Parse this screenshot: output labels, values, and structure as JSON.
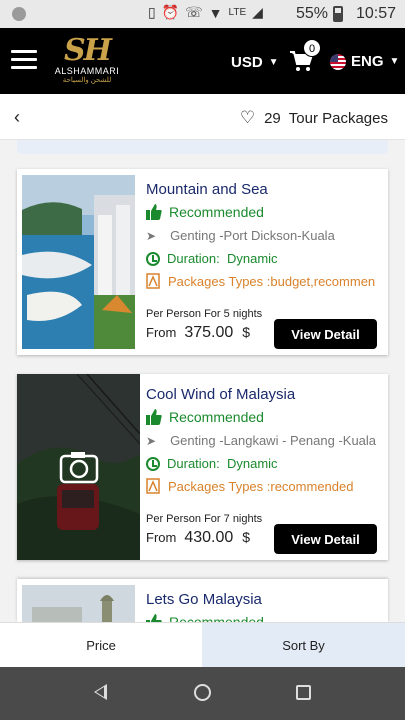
{
  "status_bar": {
    "battery": "55%",
    "time": "10:57",
    "network": "LTE"
  },
  "header": {
    "currency": "USD",
    "cart_count": "0",
    "language": "ENG",
    "logo_name": "ALSHAMMARI",
    "logo_sub": "للشحن والسياحة",
    "logo_mark": "SH"
  },
  "subheader": {
    "count": "29",
    "label": "Tour Packages"
  },
  "labels": {
    "recommended": "Recommended",
    "duration_prefix": "Duration:",
    "from": "From",
    "view_detail": "View Detail"
  },
  "packages": [
    {
      "title": "Mountain and Sea",
      "route": "Genting -Port Dickson-Kuala",
      "duration": "Dynamic",
      "types": "Packages Types :budget,recommen",
      "nights": "Per Person For 5 nights",
      "price": "375.00",
      "currency": "$"
    },
    {
      "title": "Cool Wind of Malaysia",
      "route": "Genting -Langkawi - Penang -Kuala",
      "duration": "Dynamic",
      "types": "Packages Types :recommended",
      "nights": "Per Person For 7 nights",
      "price": "430.00",
      "currency": "$"
    },
    {
      "title": "Lets Go Malaysia",
      "route": "",
      "duration": "",
      "types": "",
      "nights": "",
      "price": "",
      "currency": ""
    }
  ],
  "bottom_bar": {
    "price": "Price",
    "sort": "Sort By"
  },
  "colors": {
    "brand_gold": "#c9a24a",
    "recommended_green": "#1b8a2e",
    "types_orange": "#d9822b",
    "title_navy": "#1a2a6c"
  }
}
